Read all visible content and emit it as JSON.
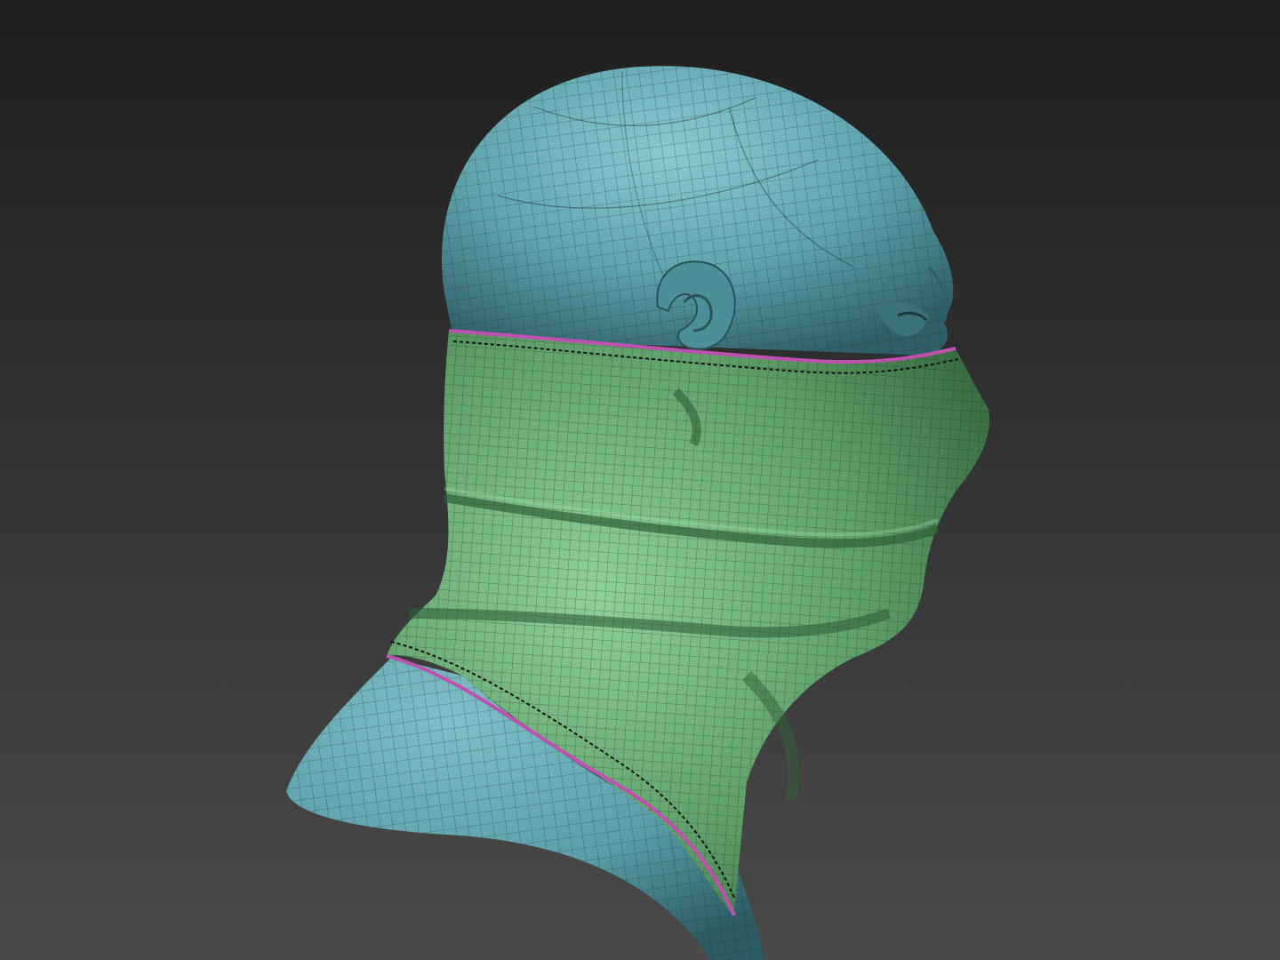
{
  "viewport": {
    "background_top": "#1e1e1e",
    "background_bottom": "#4a4a4a"
  },
  "model": {
    "head_color": "#5fa3ad",
    "head_highlight": "#8cc9d1",
    "head_shadow": "#2f6068",
    "mask_color": "#5fa06a",
    "mask_highlight": "#8fd09a",
    "mask_shadow": "#2f5f38",
    "wire_color": "#1c2a2c",
    "seam_color": "#c050b0"
  }
}
